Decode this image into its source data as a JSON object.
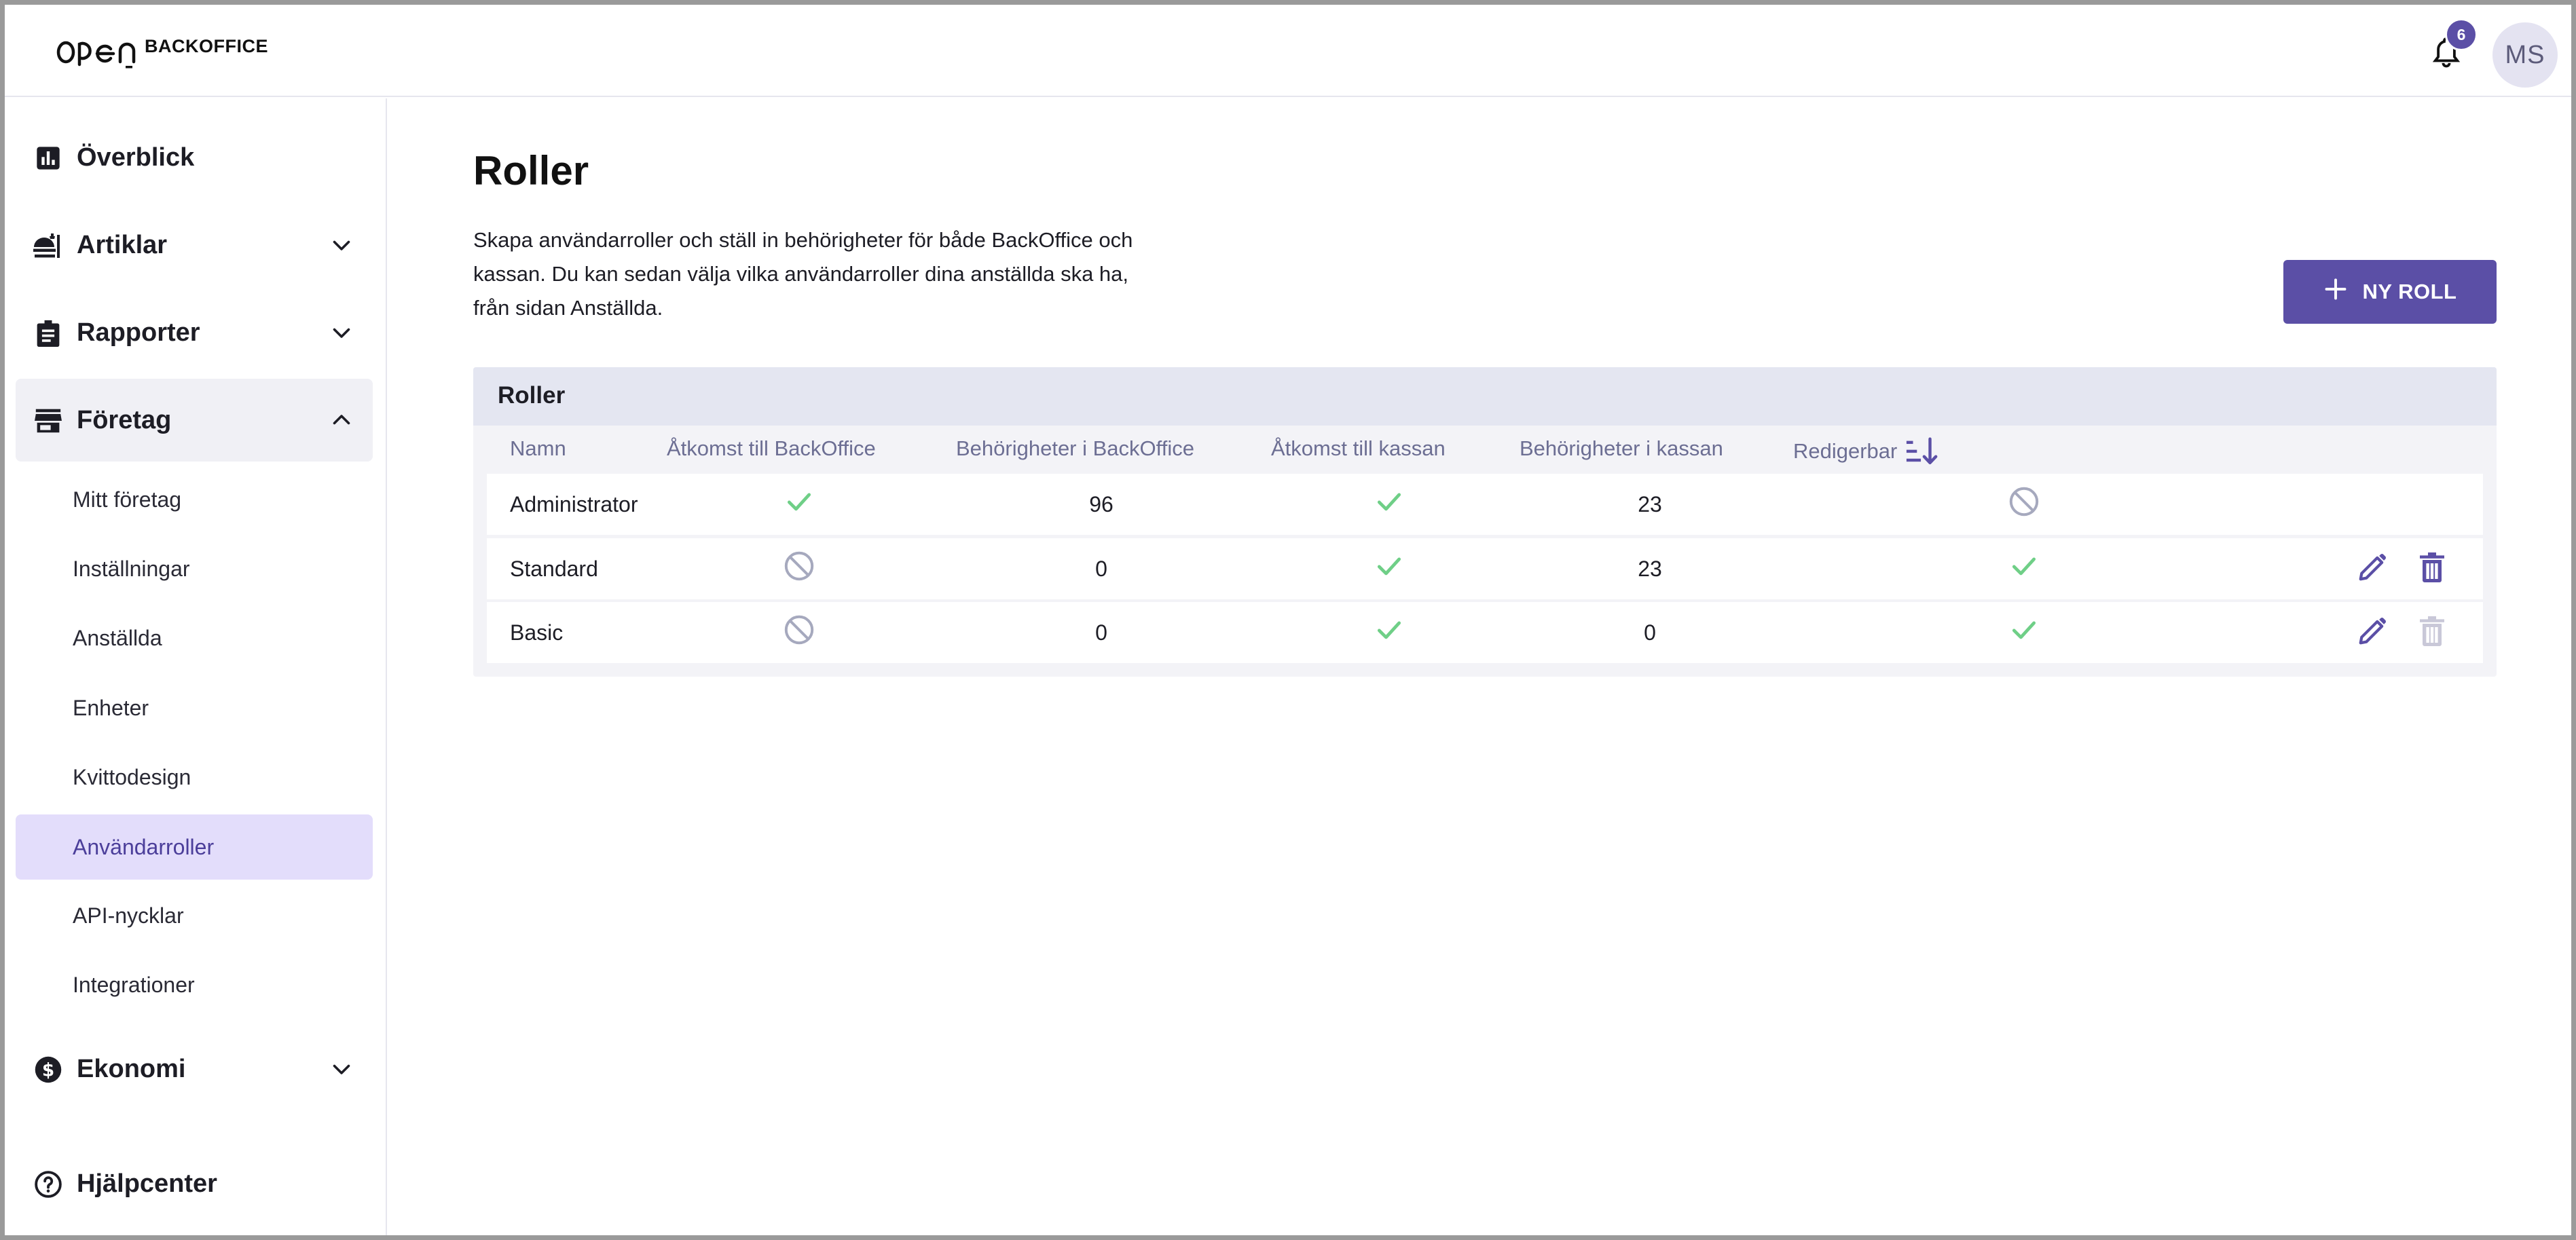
{
  "header": {
    "brand": "BACKOFFICE",
    "notifications_count": "6",
    "avatar_initials": "MS",
    "logo_icon": "open-logo-icon",
    "bell_icon": "bell-icon"
  },
  "sidebar": {
    "items": [
      {
        "label": "Överblick",
        "icon": "bar-chart-icon"
      },
      {
        "label": "Artiklar",
        "icon": "food-tray-icon"
      },
      {
        "label": "Rapporter",
        "icon": "clipboard-icon"
      },
      {
        "label": "Företag",
        "icon": "storefront-icon"
      },
      {
        "label": "Ekonomi",
        "icon": "dollar-circle-icon"
      },
      {
        "label": "Hjälpcenter",
        "icon": "help-circle-icon"
      }
    ],
    "company_sub": [
      {
        "label": "Mitt företag"
      },
      {
        "label": "Inställningar"
      },
      {
        "label": "Anställda"
      },
      {
        "label": "Enheter"
      },
      {
        "label": "Kvittodesign"
      },
      {
        "label": "Användarroller"
      },
      {
        "label": "API-nycklar"
      },
      {
        "label": "Integrationer"
      }
    ],
    "active_item": "Användarroller"
  },
  "main": {
    "title": "Roller",
    "description": "Skapa användarroller och ställ in behörigheter för både BackOffice och kassan. Du kan sedan välja vilka användarroller dina anställda ska ha, från sidan Anställda.",
    "new_role_button": "NY ROLL",
    "table": {
      "title": "Roller",
      "columns": [
        "Namn",
        "Åtkomst till BackOffice",
        "Behörigheter i BackOffice",
        "Åtkomst till kassan",
        "Behörigheter i kassan",
        "Redigerbar"
      ],
      "sort_icon": "sort-descending-icon",
      "rows": [
        {
          "name": "Administrator",
          "backoffice_access": "yes",
          "backoffice_permissions": "96",
          "pos_access": "yes",
          "pos_permissions": "23",
          "editable": "no",
          "can_edit": false,
          "can_delete": false
        },
        {
          "name": "Standard",
          "backoffice_access": "no",
          "backoffice_permissions": "0",
          "pos_access": "yes",
          "pos_permissions": "23",
          "editable": "yes",
          "can_edit": true,
          "can_delete": true
        },
        {
          "name": "Basic",
          "backoffice_access": "no",
          "backoffice_permissions": "0",
          "pos_access": "yes",
          "pos_permissions": "0",
          "editable": "yes",
          "can_edit": true,
          "can_delete": false
        }
      ]
    }
  },
  "colors": {
    "accent": "#5b4fa6",
    "active_bg": "#e3ddfb",
    "check": "#6fcf87",
    "blocked": "#a6a9be",
    "column_header": "#6c6e93"
  }
}
